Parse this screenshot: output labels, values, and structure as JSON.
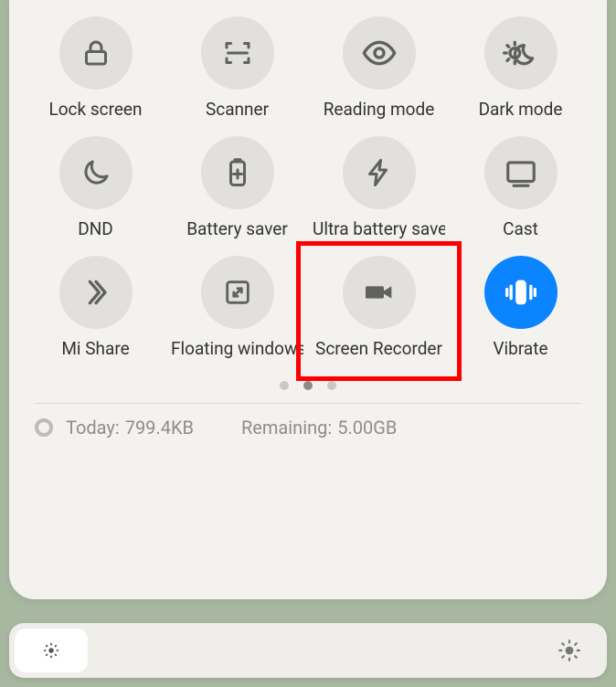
{
  "tiles": [
    {
      "id": "lock-screen",
      "label": "Lock screen",
      "icon": "lock-icon",
      "active": false
    },
    {
      "id": "scanner",
      "label": "Scanner",
      "icon": "scanner-icon",
      "active": false
    },
    {
      "id": "reading-mode",
      "label": "Reading mode",
      "icon": "eye-icon",
      "active": false
    },
    {
      "id": "dark-mode",
      "label": "Dark mode",
      "icon": "dark-mode-icon",
      "active": false
    },
    {
      "id": "dnd",
      "label": "DND",
      "icon": "moon-icon",
      "active": false
    },
    {
      "id": "battery-saver",
      "label": "Battery saver",
      "icon": "battery-plus-icon",
      "active": false
    },
    {
      "id": "ultra-battery",
      "label": "Ultra battery saver",
      "icon": "bolt-icon",
      "active": false
    },
    {
      "id": "cast",
      "label": "Cast",
      "icon": "cast-icon",
      "active": false
    },
    {
      "id": "mi-share",
      "label": "Mi Share",
      "icon": "mi-share-icon",
      "active": false
    },
    {
      "id": "floating-windows",
      "label": "Floating windows",
      "icon": "floating-window-icon",
      "active": false
    },
    {
      "id": "screen-recorder",
      "label": "Screen Recorder",
      "icon": "video-camera-icon",
      "active": false
    },
    {
      "id": "vibrate",
      "label": "Vibrate",
      "icon": "vibrate-icon",
      "active": true
    }
  ],
  "highlighted_tile": "screen-recorder",
  "pager": {
    "total": 3,
    "current": 1
  },
  "usage": {
    "today_label": "Today:",
    "today_value": "799.4KB",
    "remaining_label": "Remaining:",
    "remaining_value": "5.00GB"
  },
  "colors": {
    "tile_off": "#e1e0dc",
    "tile_on": "#0a84ff",
    "icon_off": "#606060",
    "icon_on": "#ffffff",
    "highlight": "#ff0000"
  }
}
